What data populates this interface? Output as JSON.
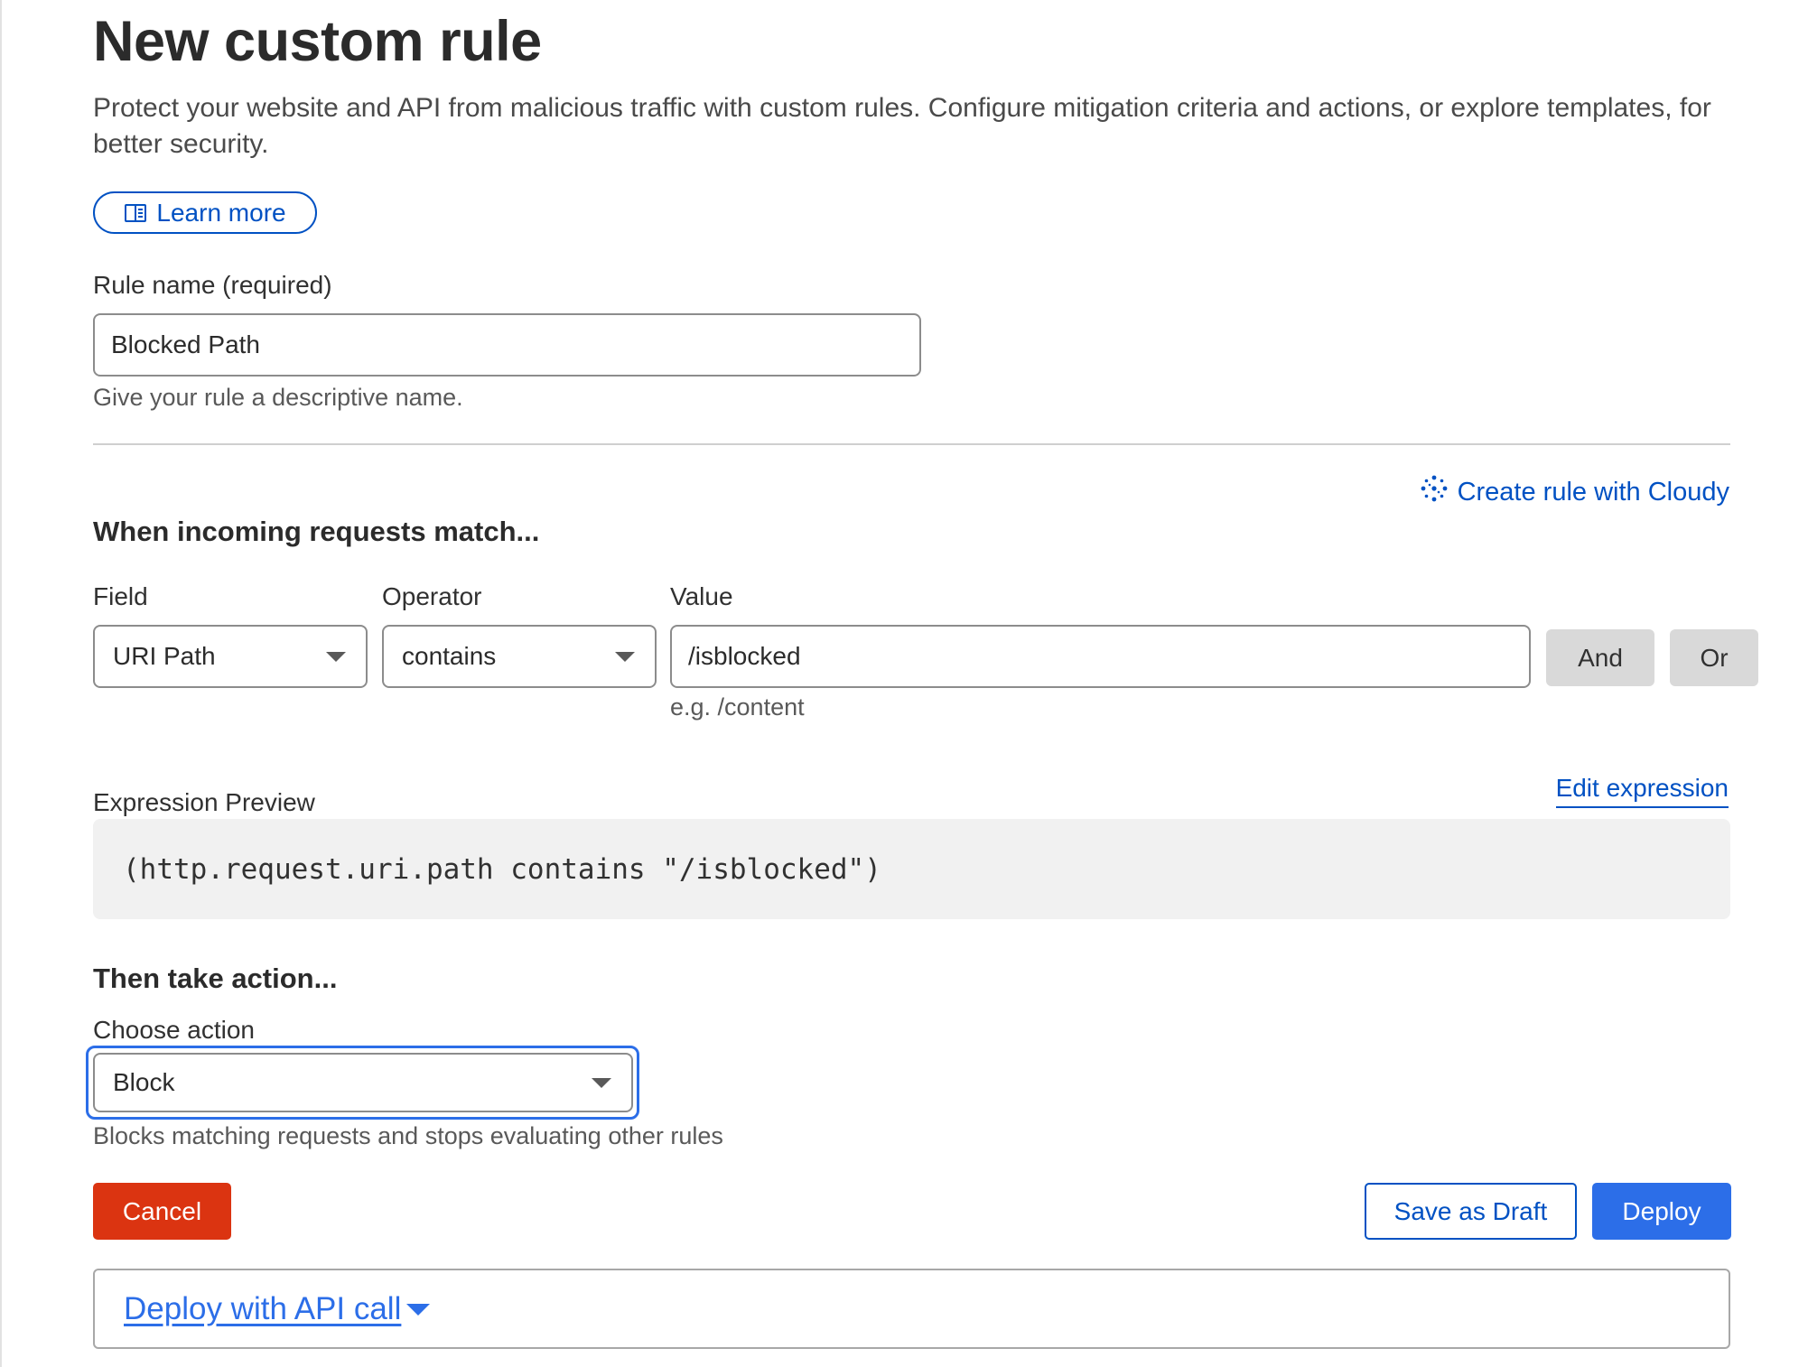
{
  "header": {
    "title": "New custom rule",
    "description": "Protect your website and API from malicious traffic with custom rules. Configure mitigation criteria and actions, or explore templates, for better security.",
    "learn_more_label": "Learn more"
  },
  "rule_name": {
    "label": "Rule name (required)",
    "value": "Blocked Path",
    "hint": "Give your rule a descriptive name."
  },
  "match": {
    "cloudy_link": "Create rule with Cloudy",
    "heading": "When incoming requests match...",
    "field_label": "Field",
    "operator_label": "Operator",
    "value_label": "Value",
    "field_value": "URI Path",
    "operator_value": "contains",
    "value_value": "/isblocked",
    "value_hint": "e.g. /content",
    "and_label": "And",
    "or_label": "Or"
  },
  "expression": {
    "label": "Expression Preview",
    "edit_link": "Edit expression",
    "code": "(http.request.uri.path contains \"/isblocked\")"
  },
  "action": {
    "heading": "Then take action...",
    "label": "Choose action",
    "value": "Block",
    "hint": "Blocks matching requests and stops evaluating other rules"
  },
  "footer": {
    "cancel_label": "Cancel",
    "save_draft_label": "Save as Draft",
    "deploy_label": "Deploy",
    "api_link": "Deploy with API call"
  },
  "colors": {
    "accent_blue": "#0051c3",
    "primary_button": "#2c6ee8",
    "danger_button": "#db3411"
  }
}
